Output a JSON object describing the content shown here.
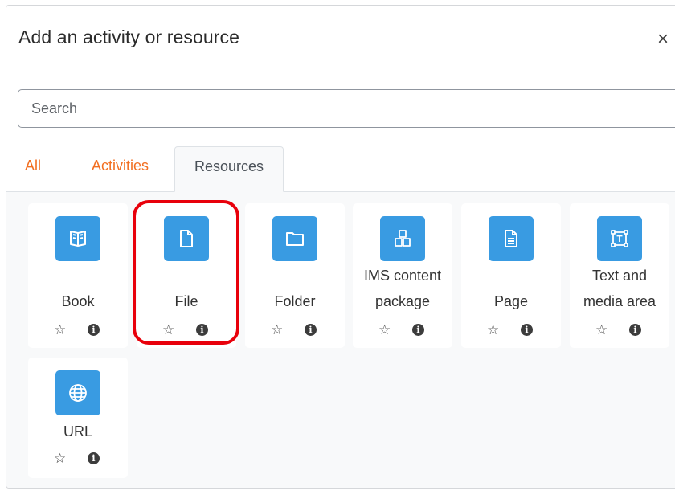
{
  "dialog": {
    "title": "Add an activity or resource",
    "close_label": "×"
  },
  "search": {
    "placeholder": "Search",
    "value": ""
  },
  "tabs": [
    {
      "label": "All",
      "active": false
    },
    {
      "label": "Activities",
      "active": false
    },
    {
      "label": "Resources",
      "active": true
    }
  ],
  "items": [
    {
      "label": "Book",
      "icon": "book-icon"
    },
    {
      "label": "File",
      "icon": "file-icon",
      "highlighted": true
    },
    {
      "label": "Folder",
      "icon": "folder-icon"
    },
    {
      "label_line1": "IMS content",
      "label_line2": "package",
      "icon": "package-icon"
    },
    {
      "label": "Page",
      "icon": "page-icon"
    },
    {
      "label_line1": "Text and",
      "label_line2": "media area",
      "icon": "text-media-icon"
    },
    {
      "label": "URL",
      "icon": "globe-icon"
    }
  ],
  "actions": {
    "star_glyph": "☆",
    "info_glyph": "i"
  },
  "colors": {
    "icon_bg": "#399be2",
    "tab_link": "#f26f21",
    "highlight": "#e8000b",
    "content_bg": "#f8f9fa"
  }
}
